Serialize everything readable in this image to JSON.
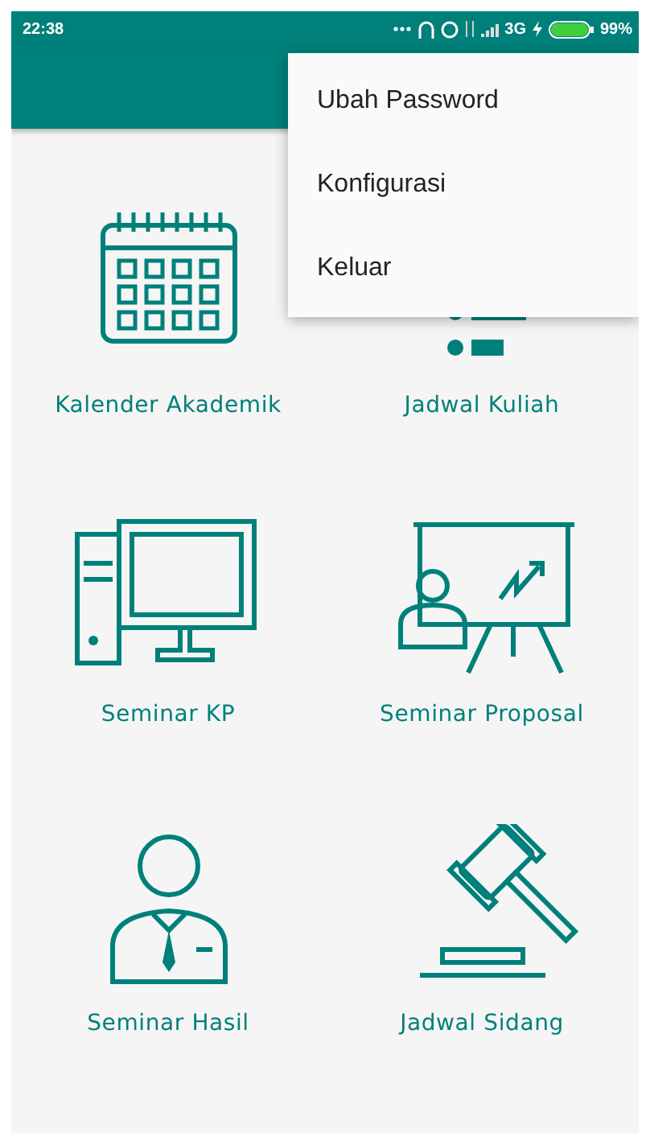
{
  "status_bar": {
    "time": "22:38",
    "network": "3G",
    "battery": "99%"
  },
  "menu": {
    "items": [
      {
        "label": "Ubah Password"
      },
      {
        "label": "Konfigurasi"
      },
      {
        "label": "Keluar"
      }
    ]
  },
  "tiles": [
    {
      "kind": "calendar",
      "label": "Kalender Akademik"
    },
    {
      "kind": "list",
      "label": "Jadwal Kuliah"
    },
    {
      "kind": "computer",
      "label": "Seminar KP"
    },
    {
      "kind": "presentation",
      "label": "Seminar Proposal"
    },
    {
      "kind": "person",
      "label": "Seminar Hasil"
    },
    {
      "kind": "gavel",
      "label": "Jadwal Sidang"
    }
  ]
}
